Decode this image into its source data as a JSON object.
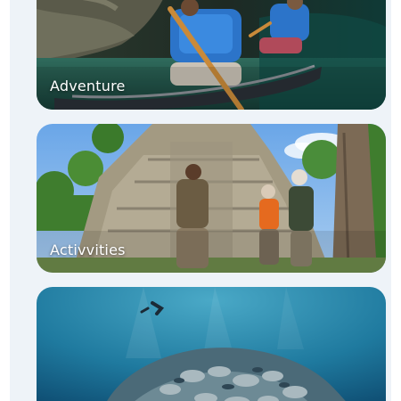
{
  "cards": [
    {
      "label": "Adventure",
      "image": "kayaking-cave-photo"
    },
    {
      "label": "Activvities",
      "image": "mayan-temple-tour-photo"
    },
    {
      "label": "",
      "image": "underwater-reef-photo"
    }
  ]
}
